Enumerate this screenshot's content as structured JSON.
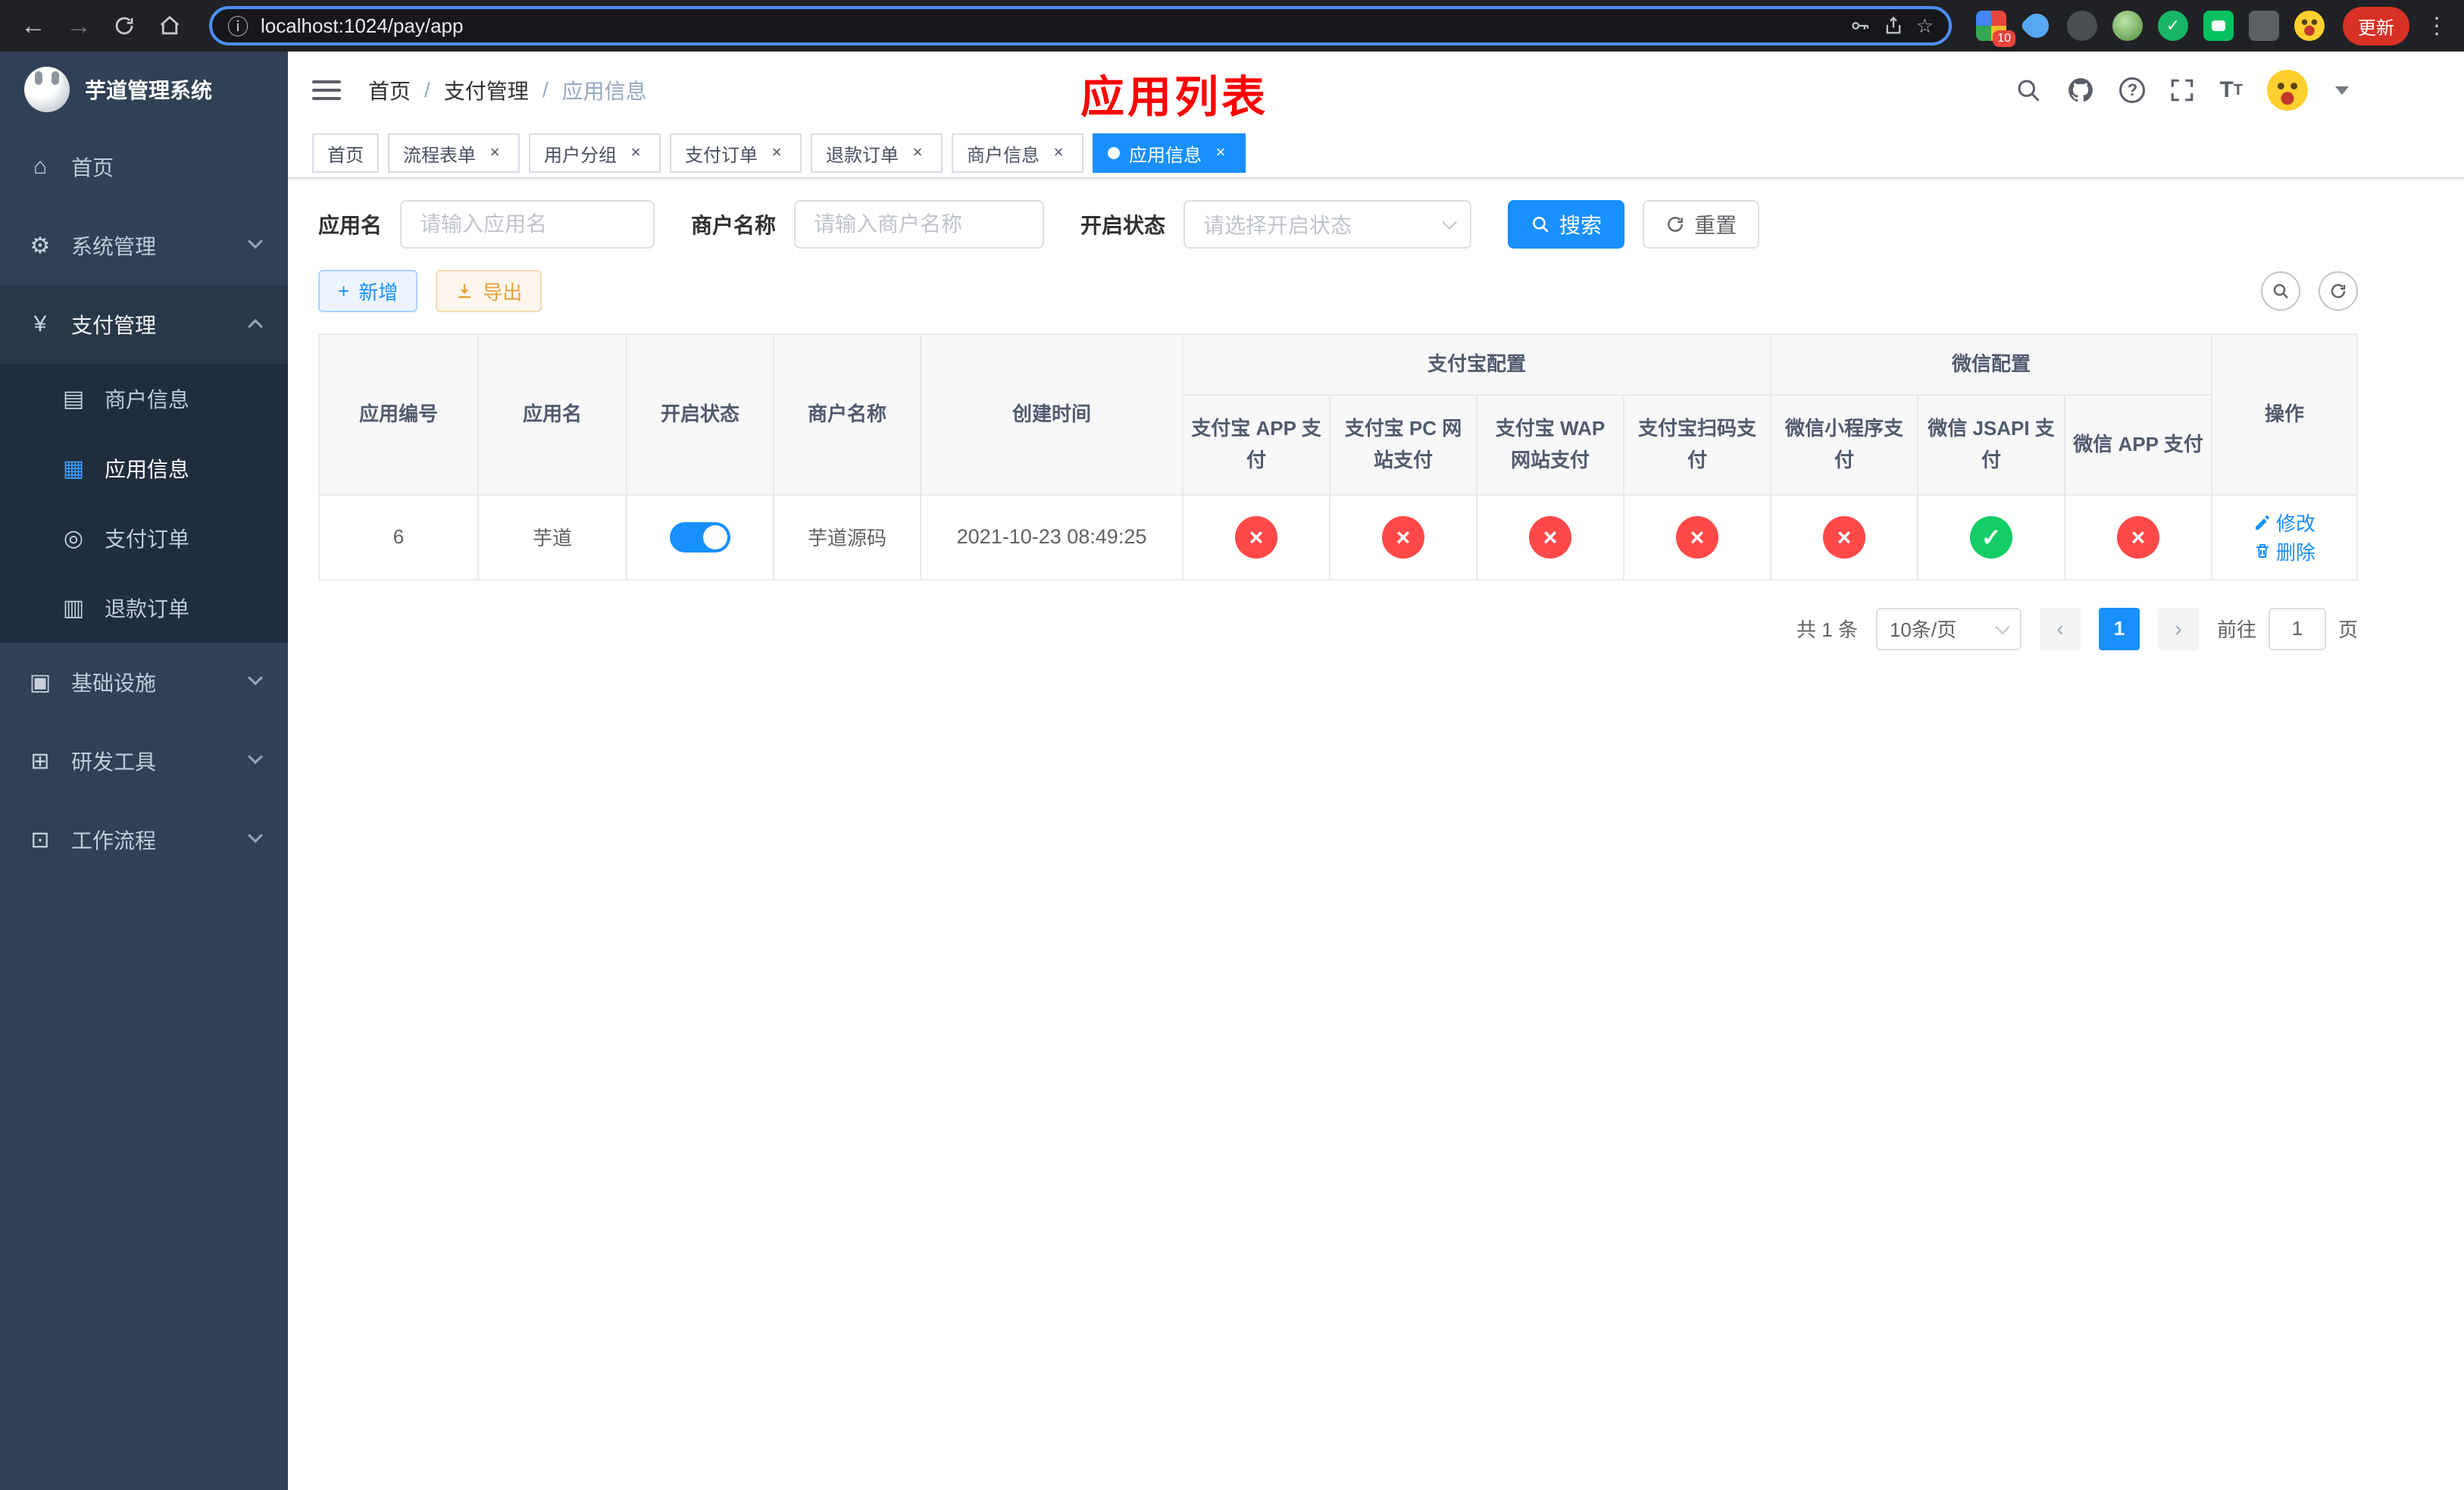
{
  "browser": {
    "url": "localhost:1024/pay/app",
    "update_label": "更新",
    "extension_badge": "10"
  },
  "sidebar": {
    "logo_title": "芋道管理系统",
    "items": [
      {
        "label": "首页",
        "icon": "⌂"
      },
      {
        "label": "系统管理",
        "icon": "⚙"
      },
      {
        "label": "支付管理",
        "icon": "¥"
      },
      {
        "label": "基础设施",
        "icon": "▣"
      },
      {
        "label": "研发工具",
        "icon": "⊞"
      },
      {
        "label": "工作流程",
        "icon": "⊡"
      }
    ],
    "submenu": [
      {
        "label": "商户信息",
        "icon": "▤"
      },
      {
        "label": "应用信息",
        "icon": "▦"
      },
      {
        "label": "支付订单",
        "icon": "◎"
      },
      {
        "label": "退款订单",
        "icon": "▥"
      }
    ]
  },
  "header": {
    "breadcrumb": [
      "首页",
      "支付管理",
      "应用信息"
    ],
    "page_title": "应用列表"
  },
  "tabs": [
    {
      "label": "首页"
    },
    {
      "label": "流程表单"
    },
    {
      "label": "用户分组"
    },
    {
      "label": "支付订单"
    },
    {
      "label": "退款订单"
    },
    {
      "label": "商户信息"
    },
    {
      "label": "应用信息"
    }
  ],
  "filters": {
    "app_name_label": "应用名",
    "app_name_placeholder": "请输入应用名",
    "merchant_label": "商户名称",
    "merchant_placeholder": "请输入商户名称",
    "status_label": "开启状态",
    "status_placeholder": "请选择开启状态",
    "search_label": "搜索",
    "reset_label": "重置"
  },
  "toolbar": {
    "add_label": "新增",
    "export_label": "导出"
  },
  "table": {
    "group_alipay": "支付宝配置",
    "group_wechat": "微信配置",
    "col_id": "应用编号",
    "col_name": "应用名",
    "col_status": "开启状态",
    "col_merchant": "商户名称",
    "col_created": "创建时间",
    "col_alipay_app": "支付宝 APP 支付",
    "col_alipay_pc": "支付宝 PC 网站支付",
    "col_alipay_wap": "支付宝 WAP 网站支付",
    "col_alipay_qr": "支付宝扫码支付",
    "col_wx_mini": "微信小程序支付",
    "col_wx_jsapi": "微信 JSAPI 支付",
    "col_wx_app": "微信 APP 支付",
    "col_actions": "操作",
    "row": {
      "id": "6",
      "name": "芋道",
      "enabled": true,
      "merchant": "芋道源码",
      "created": "2021-10-23 08:49:25",
      "statuses": {
        "alipay_app": false,
        "alipay_pc": false,
        "alipay_wap": false,
        "alipay_qr": false,
        "wx_mini": false,
        "wx_jsapi": true,
        "wx_app": false
      },
      "edit": "修改",
      "delete": "删除"
    }
  },
  "icons": {
    "check": "✓",
    "cross": "×"
  },
  "pagination": {
    "total_text": "共 1 条",
    "page_size": "10条/页",
    "current_page": "1",
    "goto_label": "前往",
    "goto_value": "1",
    "page_unit": "页"
  },
  "colors": {
    "accent": "#1890ff",
    "success": "#13ce66",
    "danger": "#ff4949",
    "warning": "#e6a23c",
    "title_red": "#ff0000",
    "sidebar_bg": "#304156",
    "submenu_bg": "#1f2d3d"
  }
}
